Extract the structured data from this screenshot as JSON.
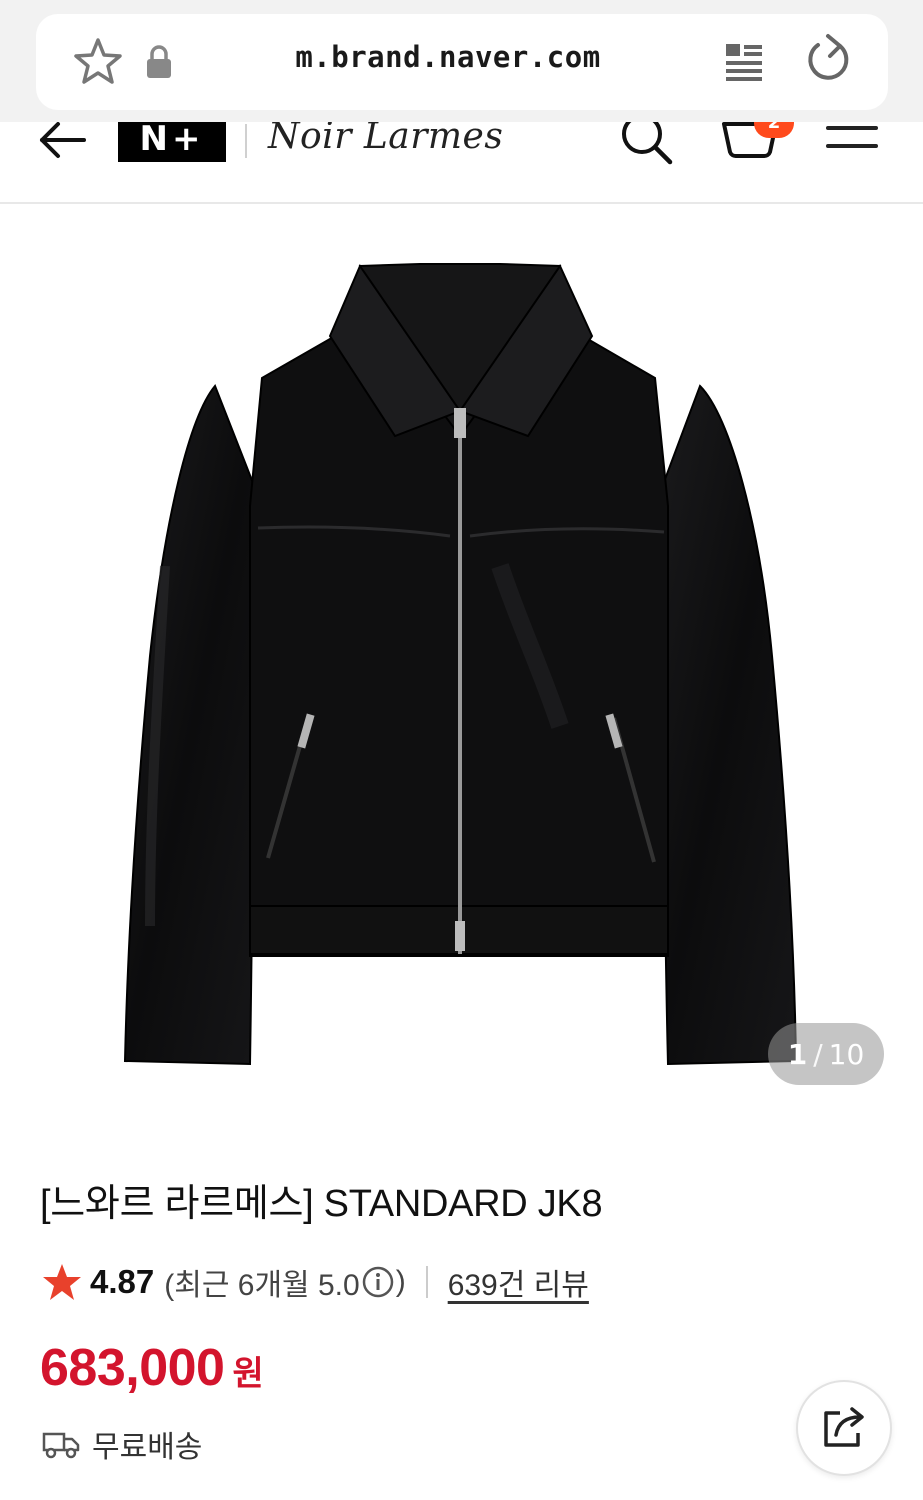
{
  "browser": {
    "url": "m.brand.naver.com",
    "icons": [
      "star-outline-icon",
      "lock-icon",
      "reader-mode-icon",
      "reload-icon"
    ]
  },
  "header": {
    "logo": "N+",
    "brand_name": "Noir Larmes",
    "cart_badge": "2",
    "icons": [
      "back-arrow-icon",
      "search-icon",
      "cart-icon",
      "menu-icon"
    ]
  },
  "gallery": {
    "current": "1",
    "separator": "/",
    "total": "10",
    "image_subject": "black leather jacket"
  },
  "product": {
    "title": "[느와르 라르메스] STANDARD JK8",
    "rating": "4.87",
    "recent_open": "(최근 6개월 5.0",
    "recent_close": ")",
    "reviews": "639건 리뷰",
    "price": "683,000",
    "currency": "원",
    "shipping": "무료배송"
  },
  "colors": {
    "price": "#d3142d",
    "rating_star": "#e8412c",
    "cart_badge": "#ff4a1c"
  }
}
